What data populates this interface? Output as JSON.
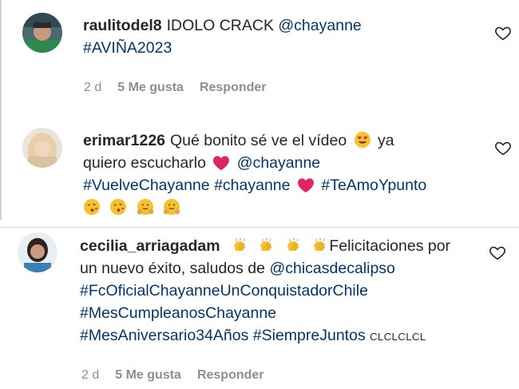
{
  "comments": [
    {
      "username": "raulitodel8",
      "text_1": "IDOLO CRACK",
      "mention": "@chayanne",
      "hashtag": "#AVIÑA2023",
      "time": "2 d",
      "likes": "5 Me gusta",
      "reply": "Responder"
    },
    {
      "username": "erimar1226",
      "text_1": "Qué bonito sé ve el vídeo",
      "text_2": "ya",
      "text_3": "quiero escucharlo",
      "mention": "@chayanne",
      "hashtag_1": "#VuelveChayanne",
      "hashtag_2": "#chayanne",
      "hashtag_3": "#TeAmoYpunto",
      "emojis": [
        "heart-eyes-emoji",
        "red-heart-emoji",
        "kissing-heart-emoji",
        "hugging-emoji"
      ]
    },
    {
      "username": "cecilia_arriagadam",
      "text_1": "Felicitaciones por",
      "text_2": "un nuevo éxito, saludos de",
      "mention": "@chicasdecalipso",
      "hashtag_1": "#FcOficialChayanneUnConquistadorChile",
      "hashtag_2": "#MesCumpleanosChayanne",
      "hashtag_3": "#MesAniversario34Años",
      "hashtag_4": "#SiempreJuntos",
      "tail": "CLCLCLCL",
      "time": "2 d",
      "likes": "5 Me gusta",
      "reply": "Responder",
      "emojis": [
        "clapping-hands-emoji"
      ]
    }
  ],
  "colors": {
    "text": "#262626",
    "link": "#00376b",
    "meta": "#8e8e8e",
    "heart_emoji": "#e0245e"
  }
}
